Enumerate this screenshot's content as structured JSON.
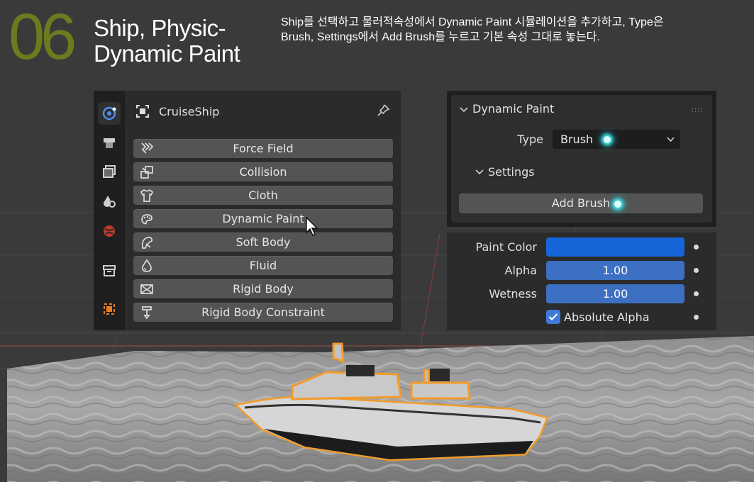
{
  "caption": {
    "step_number": "06",
    "title_line1": "Ship, Physic-",
    "title_line2": "Dynamic Paint",
    "description_line1": "Ship를  선택하고 물러적속성에서  Dynamic Paint 시뮬레이션을 추가하고, Type은",
    "description_line2": "Brush,  Settings에서 Add Brush를 누르고 기본 속성 그대로 놓는다."
  },
  "physics_panel": {
    "object_name": "CruiseShip",
    "tabs": [
      "tool-icon",
      "render-icon",
      "output-icon",
      "view-layer-icon",
      "scene-icon",
      "world-icon",
      "collection-icon",
      "object-icon"
    ],
    "buttons": [
      {
        "label": "Force Field",
        "icon": "force-field-icon"
      },
      {
        "label": "Collision",
        "icon": "collision-icon"
      },
      {
        "label": "Cloth",
        "icon": "cloth-icon"
      },
      {
        "label": "Dynamic Paint",
        "icon": "dynamic-paint-icon"
      },
      {
        "label": "Soft Body",
        "icon": "soft-body-icon"
      },
      {
        "label": "Fluid",
        "icon": "fluid-icon"
      },
      {
        "label": "Rigid Body",
        "icon": "rigid-body-icon"
      },
      {
        "label": "Rigid Body Constraint",
        "icon": "rigid-body-constraint-icon"
      }
    ]
  },
  "dynamic_paint": {
    "panel_title": "Dynamic Paint",
    "type_label": "Type",
    "type_value": "Brush",
    "settings_label": "Settings",
    "add_brush_label": "Add Brush"
  },
  "brush_settings": {
    "paint_color_label": "Paint Color",
    "paint_color_value": "#1565d8",
    "alpha_label": "Alpha",
    "alpha_value": "1.00",
    "wetness_label": "Wetness",
    "wetness_value": "1.00",
    "absolute_alpha_label": "Absolute Alpha",
    "absolute_alpha_checked": true
  },
  "colors": {
    "step_number": "#6e7a1e",
    "highlight_glow": "#3fe0e6",
    "selection_outline": "#f29b2a",
    "field_blue": "#3d6fc2"
  }
}
